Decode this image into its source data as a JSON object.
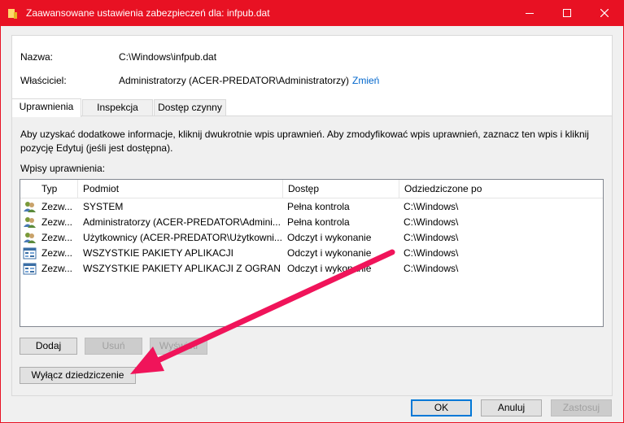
{
  "window": {
    "title": "Zaawansowane ustawienia zabezpieczeń dla: infpub.dat"
  },
  "info": {
    "name_label": "Nazwa:",
    "name_value": "C:\\Windows\\infpub.dat",
    "owner_label": "Właściciel:",
    "owner_value": "Administratorzy (ACER-PREDATOR\\Administratorzy)",
    "change_link": "Zmień"
  },
  "tabs": [
    {
      "label": "Uprawnienia",
      "active": true
    },
    {
      "label": "Inspekcja",
      "active": false
    },
    {
      "label": "Dostęp czynny",
      "active": false
    }
  ],
  "permissions": {
    "description": "Aby uzyskać dodatkowe informacje, kliknij dwukrotnie wpis uprawnień. Aby zmodyfikować wpis uprawnień, zaznacz ten wpis i kliknij pozycję Edytuj (jeśli jest dostępna).",
    "list_label": "Wpisy uprawnienia:",
    "columns": [
      "Typ",
      "Podmiot",
      "Dostęp",
      "Odziedziczone po"
    ],
    "rows": [
      {
        "type": "Zezw...",
        "principal": "SYSTEM",
        "access": "Pełna kontrola",
        "inherited": "C:\\Windows\\",
        "icon": "users-icon"
      },
      {
        "type": "Zezw...",
        "principal": "Administratorzy (ACER-PREDATOR\\Admini...",
        "access": "Pełna kontrola",
        "inherited": "C:\\Windows\\",
        "icon": "users-icon"
      },
      {
        "type": "Zezw...",
        "principal": "Użytkownicy (ACER-PREDATOR\\Użytkowni...",
        "access": "Odczyt i wykonanie",
        "inherited": "C:\\Windows\\",
        "icon": "users-icon"
      },
      {
        "type": "Zezw...",
        "principal": "WSZYSTKIE PAKIETY APLIKACJI",
        "access": "Odczyt i wykonanie",
        "inherited": "C:\\Windows\\",
        "icon": "app-package-icon"
      },
      {
        "type": "Zezw...",
        "principal": "WSZYSTKIE PAKIETY APLIKACJI Z OGRANIC...",
        "access": "Odczyt i wykonanie",
        "inherited": "C:\\Windows\\",
        "icon": "app-package-icon"
      }
    ],
    "add_button": "Dodaj",
    "remove_button": "Usuń",
    "view_button": "Wyświetl",
    "disable_inheritance_button": "Wyłącz dziedziczenie"
  },
  "footer": {
    "ok_button": "OK",
    "cancel_button": "Anuluj",
    "apply_button": "Zastosuj"
  },
  "colors": {
    "titlebar": "#e81123",
    "link": "#0066cc",
    "annotation_arrow": "#f0145a"
  }
}
